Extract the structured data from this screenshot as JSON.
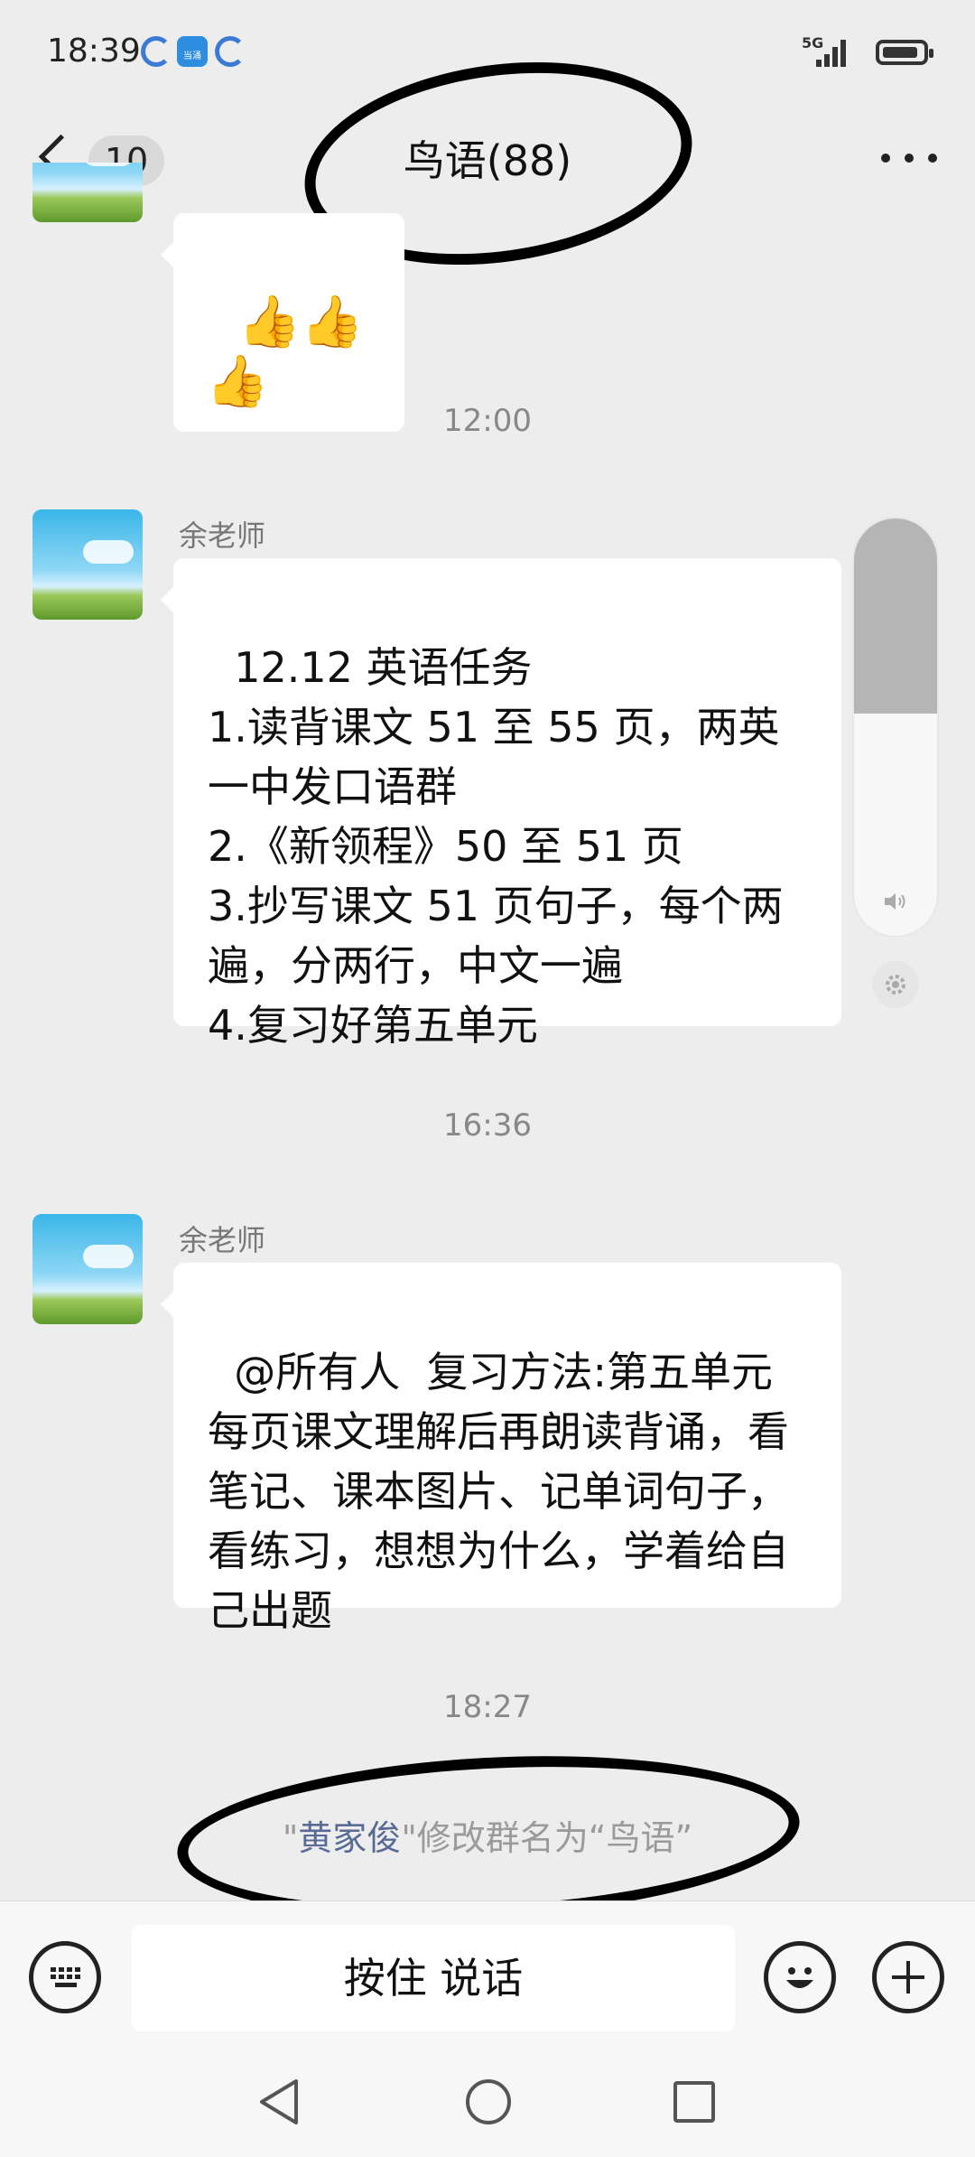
{
  "status_bar": {
    "time": "18:39",
    "network": "5G",
    "weather_badge": "当涌"
  },
  "header": {
    "back_badge": "10",
    "title": "鸟语(88)"
  },
  "messages": [
    {
      "type": "emoji",
      "text": "👍👍👍"
    },
    {
      "type": "time",
      "text": "12:00"
    },
    {
      "type": "text",
      "sender": "余老师",
      "text": "12.12 英语任务\n1.读背课文 51 至 55 页，两英一中发口语群\n2.《新领程》50 至 51 页\n3.抄写课文 51 页句子，每个两遍，分两行，中文一遍\n4.复习好第五单元"
    },
    {
      "type": "time",
      "text": "16:36"
    },
    {
      "type": "text",
      "sender": "余老师",
      "text": "@所有人  复习方法:第五单元每页课文理解后再朗读背诵，看笔记、课本图片、记单词句子，看练习，想想为什么，学着给自己出题"
    },
    {
      "type": "time",
      "text": "18:27"
    },
    {
      "type": "system",
      "pre": "\"",
      "name": "黄家俊",
      "post": "\"修改群名为“鸟语”"
    }
  ],
  "volume": {
    "level_percent": 53
  },
  "input_bar": {
    "hold_to_talk": "按住 说话"
  },
  "colors": {
    "background": "#ededed",
    "bubble": "#ffffff",
    "link_name": "#576b95"
  }
}
